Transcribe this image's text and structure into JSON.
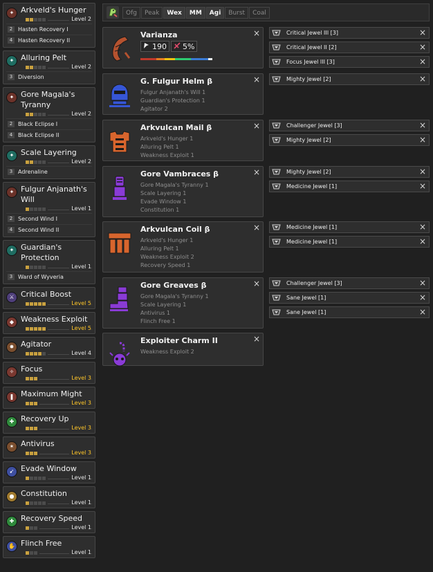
{
  "skills": [
    {
      "name_lines": [
        "Arkveld's Hunger"
      ],
      "level": "Level 2",
      "filled": 2,
      "total": 5,
      "max": false,
      "icon": "sigil-icon",
      "color": "#6b3229",
      "glyph": "✦",
      "subs": [
        {
          "num": "2",
          "text": "Hasten Recovery I"
        },
        {
          "num": "4",
          "text": "Hasten Recovery II"
        }
      ]
    },
    {
      "name_lines": [
        "Alluring Pelt"
      ],
      "level": "Level 2",
      "filled": 2,
      "total": 5,
      "max": false,
      "icon": "sigil-icon",
      "color": "#1f6d62",
      "glyph": "✦",
      "subs": [
        {
          "num": "3",
          "text": "Diversion"
        }
      ]
    },
    {
      "name_lines": [
        "Gore Magala's",
        "Tyranny"
      ],
      "level": "Level 2",
      "filled": 2,
      "total": 5,
      "max": false,
      "icon": "sigil-icon",
      "color": "#6b3229",
      "glyph": "✦",
      "subs": [
        {
          "num": "2",
          "text": "Black Eclipse I"
        },
        {
          "num": "4",
          "text": "Black Eclipse II"
        }
      ]
    },
    {
      "name_lines": [
        "Scale Layering"
      ],
      "level": "Level 2",
      "filled": 2,
      "total": 5,
      "max": false,
      "icon": "sigil-icon",
      "color": "#1f6d62",
      "glyph": "✦",
      "subs": [
        {
          "num": "3",
          "text": "Adrenaline"
        }
      ]
    },
    {
      "name_lines": [
        "Fulgur Anjanath's",
        "Will"
      ],
      "level": "Level 1",
      "filled": 1,
      "total": 5,
      "max": false,
      "icon": "sigil-icon",
      "color": "#6b3229",
      "glyph": "✦",
      "subs": [
        {
          "num": "2",
          "text": "Second Wind I"
        },
        {
          "num": "4",
          "text": "Second Wind II"
        }
      ]
    },
    {
      "name_lines": [
        "Guardian's",
        "Protection"
      ],
      "level": "Level 1",
      "filled": 1,
      "total": 5,
      "max": false,
      "icon": "sigil-icon",
      "color": "#1f6d62",
      "glyph": "✦",
      "subs": [
        {
          "num": "3",
          "text": "Ward of Wyveria"
        }
      ]
    },
    {
      "name_lines": [
        "Critical Boost"
      ],
      "level": "Level 5",
      "filled": 5,
      "total": 5,
      "max": true,
      "icon": "crit-boost-icon",
      "color": "#4e3e7a",
      "glyph": "⚔",
      "subs": []
    },
    {
      "name_lines": [
        "Weakness Exploit"
      ],
      "level": "Level 5",
      "filled": 5,
      "total": 5,
      "max": true,
      "icon": "weakness-exploit-icon",
      "color": "#7a3830",
      "glyph": "◆",
      "subs": []
    },
    {
      "name_lines": [
        "Agitator"
      ],
      "level": "Level 4",
      "filled": 4,
      "total": 5,
      "max": false,
      "icon": "agitator-icon",
      "color": "#7a4e2e",
      "glyph": "✸",
      "subs": []
    },
    {
      "name_lines": [
        "Focus"
      ],
      "level": "Level 3",
      "filled": 3,
      "total": 3,
      "max": true,
      "icon": "focus-icon",
      "color": "#7a3830",
      "glyph": "✧",
      "subs": []
    },
    {
      "name_lines": [
        "Maximum Might"
      ],
      "level": "Level 3",
      "filled": 3,
      "total": 3,
      "max": true,
      "icon": "maximum-might-icon",
      "color": "#7a3830",
      "glyph": "❚",
      "subs": []
    },
    {
      "name_lines": [
        "Recovery Up"
      ],
      "level": "Level 3",
      "filled": 3,
      "total": 3,
      "max": true,
      "icon": "recovery-up-icon",
      "color": "#2f8a3c",
      "glyph": "✚",
      "subs": []
    },
    {
      "name_lines": [
        "Antivirus"
      ],
      "level": "Level 3",
      "filled": 3,
      "total": 3,
      "max": true,
      "icon": "antivirus-icon",
      "color": "#7a4e2e",
      "glyph": "✶",
      "subs": []
    },
    {
      "name_lines": [
        "Evade Window"
      ],
      "level": "Level 1",
      "filled": 1,
      "total": 5,
      "max": false,
      "icon": "evade-window-icon",
      "color": "#3e4fa0",
      "glyph": "➹",
      "subs": []
    },
    {
      "name_lines": [
        "Constitution"
      ],
      "level": "Level 1",
      "filled": 1,
      "total": 5,
      "max": false,
      "icon": "constitution-icon",
      "color": "#a07a2e",
      "glyph": "●",
      "subs": []
    },
    {
      "name_lines": [
        "Recovery Speed"
      ],
      "level": "Level 1",
      "filled": 1,
      "total": 3,
      "max": false,
      "icon": "recovery-speed-icon",
      "color": "#2f8a3c",
      "glyph": "✚",
      "subs": []
    },
    {
      "name_lines": [
        "Flinch Free"
      ],
      "level": "Level 1",
      "filled": 1,
      "total": 3,
      "max": false,
      "icon": "flinch-free-icon",
      "color": "#3e4fa0",
      "glyph": "✋",
      "subs": []
    }
  ],
  "filter": {
    "icon": "filter-monster-icon",
    "chips": [
      {
        "label": "Ofg",
        "active": false
      },
      {
        "label": "Peak",
        "active": false
      },
      {
        "label": "Wex",
        "active": true
      },
      {
        "label": "MM",
        "active": true
      },
      {
        "label": "Agi",
        "active": true
      },
      {
        "label": "Burst",
        "active": false
      },
      {
        "label": "Coal",
        "active": false
      }
    ]
  },
  "weapon": {
    "name": "Varianza",
    "attack": "190",
    "affinity": "5%",
    "icon": "great-sword-icon",
    "attack_icon": "attack-icon",
    "affinity_icon": "affinity-icon",
    "sharpness": [
      {
        "color": "#c0392b",
        "share": 0.22
      },
      {
        "color": "#e67e22",
        "share": 0.12
      },
      {
        "color": "#f1c40f",
        "share": 0.14
      },
      {
        "color": "#2ecc71",
        "share": 0.22
      },
      {
        "color": "#3a7bd5",
        "share": 0.24
      },
      {
        "color": "#ecf0f1",
        "share": 0.06
      }
    ]
  },
  "armor": [
    {
      "name": "G. Fulgur Helm β",
      "icon": "helm-icon",
      "color": "#3656d6",
      "skills": [
        "Fulgur Anjanath's Will 1",
        "Guardian's Protection 1",
        "Agitator 2"
      ]
    },
    {
      "name": "Arkvulcan Mail β",
      "icon": "chest-icon",
      "color": "#d8652d",
      "skills": [
        "Arkveld's Hunger 1",
        "Alluring Pelt 1",
        "Weakness Exploit 1"
      ]
    },
    {
      "name": "Gore Vambraces β",
      "icon": "arms-icon",
      "color": "#8a3bd6",
      "skills": [
        "Gore Magala's Tyranny 1",
        "Scale Layering 1",
        "Evade Window 1",
        "Constitution 1"
      ]
    },
    {
      "name": "Arkvulcan Coil β",
      "icon": "waist-icon",
      "color": "#d8652d",
      "skills": [
        "Arkveld's Hunger 1",
        "Alluring Pelt 1",
        "Weakness Exploit 2",
        "Recovery Speed 1"
      ]
    },
    {
      "name": "Gore Greaves β",
      "icon": "legs-icon",
      "color": "#8a3bd6",
      "skills": [
        "Gore Magala's Tyranny 1",
        "Scale Layering 1",
        "Antivirus 1",
        "Flinch Free 1"
      ]
    },
    {
      "name": "Exploiter Charm II",
      "icon": "charm-icon",
      "color": "#8a3bd6",
      "skills": [
        "Weakness Exploit 2"
      ]
    }
  ],
  "jewels": [
    {
      "group": 0,
      "name": "Critical Jewel III [3]",
      "icon": "jewel-slot-3-icon"
    },
    {
      "group": 0,
      "name": "Critical Jewel II [2]",
      "icon": "jewel-slot-2-icon"
    },
    {
      "group": 0,
      "name": "Focus Jewel III [3]",
      "icon": "jewel-slot-3-icon"
    },
    {
      "group": 1,
      "name": "Mighty Jewel [2]",
      "icon": "jewel-slot-2-icon"
    },
    {
      "group": 2,
      "name": "Challenger Jewel [3]",
      "icon": "jewel-slot-3-icon"
    },
    {
      "group": 2,
      "name": "Mighty Jewel [2]",
      "icon": "jewel-slot-2-icon"
    },
    {
      "group": 3,
      "name": "Mighty Jewel [2]",
      "icon": "jewel-slot-2-icon"
    },
    {
      "group": 3,
      "name": "Medicine Jewel [1]",
      "icon": "jewel-slot-1-icon"
    },
    {
      "group": 4,
      "name": "Medicine Jewel [1]",
      "icon": "jewel-slot-1-icon"
    },
    {
      "group": 4,
      "name": "Medicine Jewel [1]",
      "icon": "jewel-slot-1-icon"
    },
    {
      "group": 5,
      "name": "Challenger Jewel [3]",
      "icon": "jewel-slot-3-icon"
    },
    {
      "group": 5,
      "name": "Sane Jewel [1]",
      "icon": "jewel-slot-1-icon"
    },
    {
      "group": 5,
      "name": "Sane Jewel [1]",
      "icon": "jewel-slot-1-icon"
    }
  ],
  "close_glyph": "×"
}
